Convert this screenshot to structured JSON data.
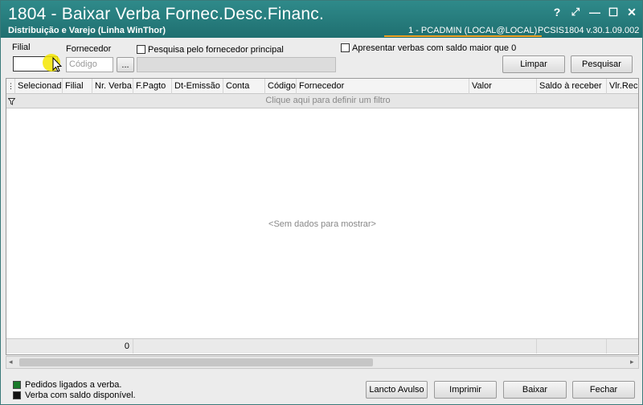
{
  "titlebar": {
    "title": "1804 - Baixar Verba Fornec.Desc.Financ.",
    "subtitle": "Distribuição e Varejo (Linha WinThor)",
    "user": "1 - PCADMIN (LOCAL@LOCAL)",
    "version": "PCSIS1804  v.30.1.09.002",
    "help_glyph": "?",
    "expand_glyph": "⤢",
    "minimize_glyph": "—",
    "maximize_glyph": "☐",
    "close_glyph": "✕"
  },
  "filters": {
    "filial_label": "Filial",
    "filial_value": "",
    "fornecedor_label": "Fornecedor",
    "codigo_placeholder": "Código",
    "lookup_label": "...",
    "fornecedor_principal_label": "Pesquisa pelo fornecedor principal",
    "saldo_label": "Apresentar verbas com saldo maior que 0",
    "limpar_label": "Limpar",
    "pesquisar_label": "Pesquisar"
  },
  "grid": {
    "columns": [
      "Selecionad",
      "Filial",
      "Nr. Verba",
      "F.Pagto",
      "Dt-Emissão",
      "Conta",
      "Código",
      "Fornecedor",
      "Valor",
      "Saldo à receber",
      "Vlr.Rece"
    ],
    "filter_text": "Clique aqui para definir um filtro",
    "empty_text": "<Sem dados para mostrar>",
    "footer_count": "0"
  },
  "legend": {
    "item1": "Pedidos ligados a verba.",
    "item1_color": "#1a7a2a",
    "item2": "Verba com saldo disponível.",
    "item2_color": "#111111"
  },
  "actions": {
    "lancto_label": "Lancto Avulso",
    "imprimir_label": "Imprimir",
    "baixar_label": "Baixar",
    "fechar_label": "Fechar"
  },
  "colors": {
    "titlebar": "#2a8080",
    "accent_underline": "#f0a020",
    "cursor_highlight": "#f5e600"
  }
}
